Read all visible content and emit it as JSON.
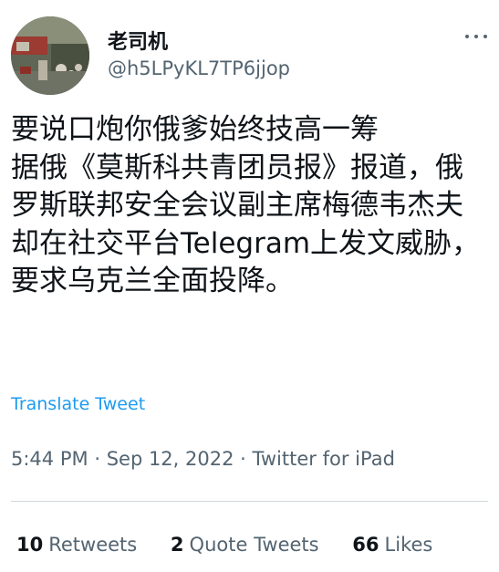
{
  "user": {
    "display_name": "老司机",
    "handle": "@h5LPyKL7TP6jjop",
    "avatar_icon": "avatar-photo"
  },
  "tweet": {
    "text": "要说口炮你俄爹始终技高一筹\n据俄《莫斯科共青团员报》报道，俄罗斯联邦安全会议副主席梅德韦杰夫却在社交平台Telegram上发文威胁，要求乌克兰全面投降。",
    "translate_label": "Translate Tweet",
    "time": "5:44 PM",
    "date": "Sep 12, 2022",
    "source": "Twitter for iPad",
    "separator": "·"
  },
  "stats": {
    "retweets_count": "10",
    "retweets_label": "Retweets",
    "quotes_count": "2",
    "quotes_label": "Quote Tweets",
    "likes_count": "66",
    "likes_label": "Likes"
  },
  "colors": {
    "text": "#0f1419",
    "secondary": "#536471",
    "link": "#1d9bf0",
    "divider": "#cfd9de"
  }
}
